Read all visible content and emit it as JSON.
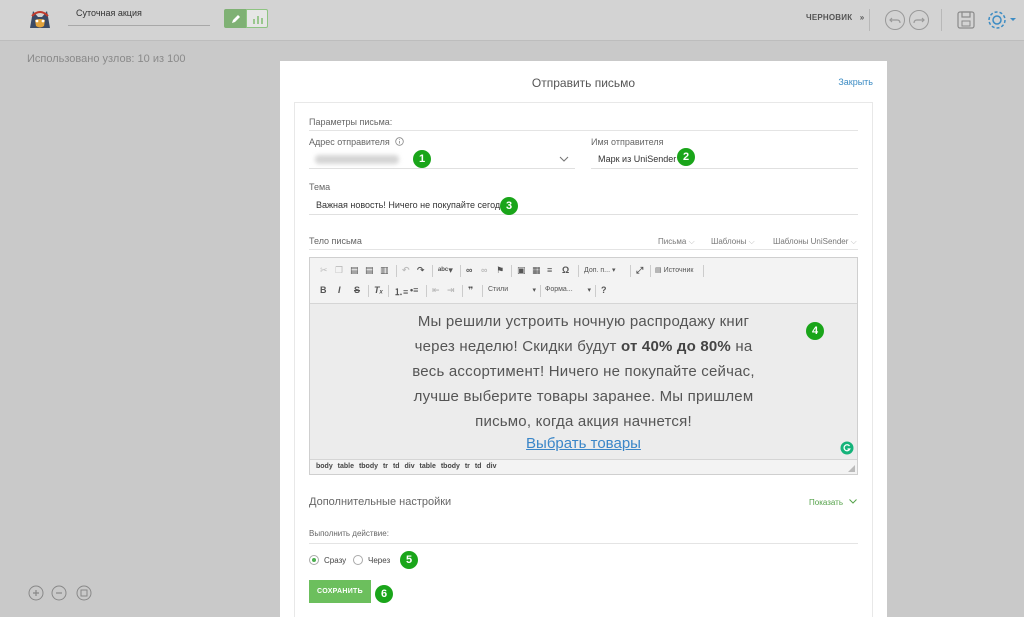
{
  "header": {
    "campaign_name": "Суточная акция",
    "status": "ЧЕРНОВИК",
    "status_caret": "»"
  },
  "workspace": {
    "nodes_used": "Использовано узлов: 10 из 100"
  },
  "modal": {
    "title": "Отправить письмо",
    "close": "Закрыть",
    "params_heading": "Параметры письма:",
    "sender_address_label": "Адрес отправителя",
    "sender_name_label": "Имя отправителя",
    "sender_name_value": "Марк из UniSender",
    "subject_label": "Тема",
    "subject_value": "Важная новость! Ничего не покупайте сегодня",
    "body_label": "Тело письма",
    "body_links": [
      "Письма",
      "Шаблоны",
      "Шаблоны UniSender"
    ],
    "toolbar": {
      "extra": "Доп. п...",
      "source": "Источник",
      "styles": "Стили",
      "format": "Форма..."
    },
    "content": {
      "line1": "Мы решили устроить ночную распродажу книг",
      "line2a": "через неделю! Скидки будут ",
      "line2b": "от 40% до 80%",
      "line2c": " на",
      "line3": "весь ассортимент! Ничего не покупайте сейчас,",
      "line4": "лучше выберите товары заранее. Мы пришлем",
      "line5": "письмо, когда акция начнется!",
      "link": "Выбрать товары"
    },
    "element_path": "body table tbody tr td div table tbody tr td div",
    "advanced_label": "Дополнительные настройки",
    "advanced_toggle": "Показать",
    "action_label": "Выполнить действие:",
    "option_now": "Сразу",
    "option_later": "Через",
    "save_button": "СОХРАНИТЬ"
  },
  "markers": [
    "1",
    "2",
    "3",
    "4",
    "5",
    "6"
  ],
  "colors": {
    "accent_green": "#6cbf5d",
    "marker_green": "#1aa51a",
    "link_blue": "#3a86c8"
  }
}
